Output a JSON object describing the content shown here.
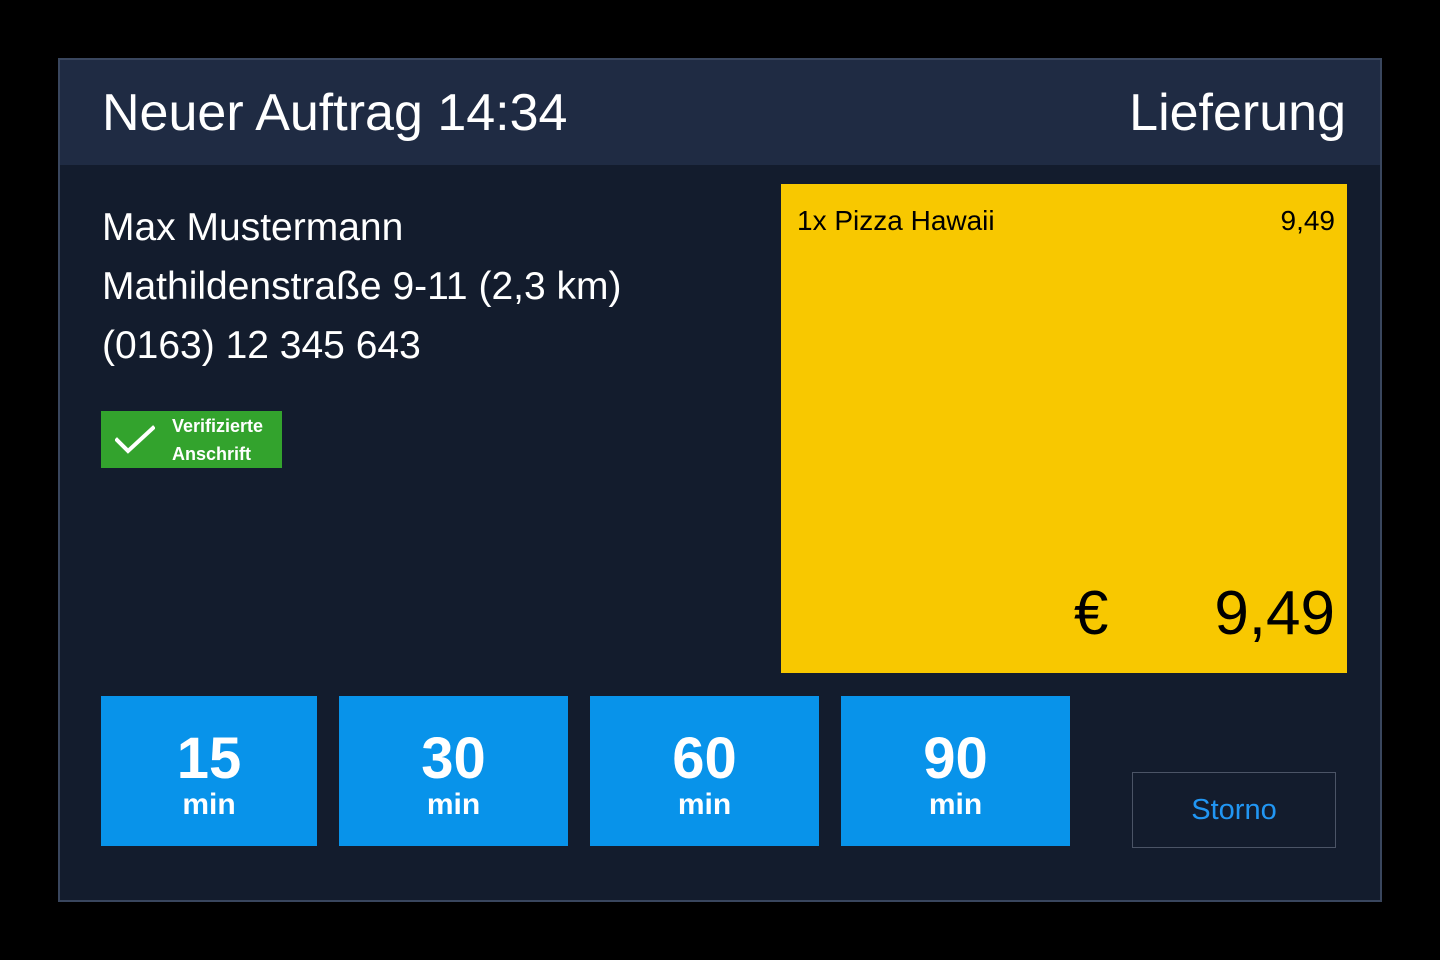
{
  "header": {
    "label": "Neuer Auftrag",
    "time": "14:34",
    "order_type": "Lieferung"
  },
  "customer": {
    "name": "Max Mustermann",
    "address": "Mathildenstraße 9-11 (2,3 km)",
    "phone": "(0163) 12 345 643"
  },
  "verified_badge": {
    "icon": "check-icon",
    "lines": [
      "Verifizierte",
      "Anschrift"
    ]
  },
  "order": {
    "items": [
      {
        "label": "1x Pizza Hawaii",
        "price": "9,49"
      }
    ],
    "currency": "€",
    "total": "9,49"
  },
  "time_buttons": [
    {
      "value": "15",
      "unit": "min"
    },
    {
      "value": "30",
      "unit": "min"
    },
    {
      "value": "60",
      "unit": "min"
    },
    {
      "value": "90",
      "unit": "min"
    }
  ],
  "cancel_button": {
    "label": "Storno"
  },
  "colors": {
    "header_bg": "#1f2b43",
    "body_bg": "#131c2d",
    "order_card": "#f8c800",
    "time_button": "#0893ea",
    "verified_badge": "#33a32d",
    "cancel_text": "#2196f3"
  }
}
